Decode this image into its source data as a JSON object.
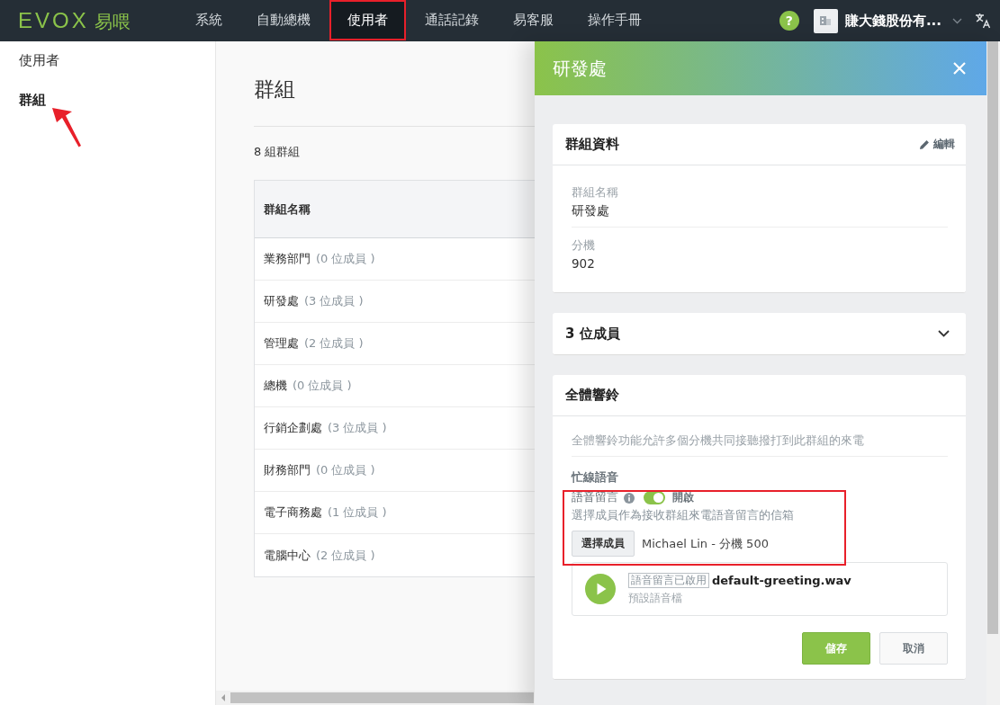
{
  "top_bar": {
    "logo": {
      "wordmark": "EVOX",
      "name": "易喂"
    },
    "nav": [
      {
        "label": "系統",
        "selected": false
      },
      {
        "label": "自動總機",
        "selected": false
      },
      {
        "label": "使用者",
        "selected": true
      },
      {
        "label": "通話記錄",
        "selected": false
      },
      {
        "label": "易客服",
        "selected": false
      },
      {
        "label": "操作手冊",
        "selected": false
      }
    ],
    "help": "?",
    "company": "賺大錢股份有..."
  },
  "sidebar": {
    "items": [
      {
        "label": "使用者",
        "selected": false
      },
      {
        "label": "群組",
        "selected": true
      }
    ]
  },
  "main": {
    "title": "群組",
    "count": "8 組群組",
    "table": {
      "columns": [
        "群組名稱"
      ],
      "rows": [
        {
          "name": "業務部門",
          "members": "(0 位成員 )"
        },
        {
          "name": "研發處",
          "members": "(3 位成員 )"
        },
        {
          "name": "管理處",
          "members": "(2 位成員 )"
        },
        {
          "name": "總機",
          "members": "(0 位成員 )"
        },
        {
          "name": "行銷企劃處",
          "members": "(3 位成員 )"
        },
        {
          "name": "財務部門",
          "members": "(0 位成員 )"
        },
        {
          "name": "電子商務處",
          "members": "(1 位成員 )"
        },
        {
          "name": "電腦中心",
          "members": "(2 位成員 )"
        }
      ]
    }
  },
  "drawer": {
    "title": "研發處",
    "info_card": {
      "title": "群組資料",
      "edit": "編輯",
      "fields": [
        {
          "label": "群組名稱",
          "value": "研發處"
        },
        {
          "label": "分機",
          "value": "902"
        }
      ]
    },
    "members_card": {
      "title": "3 位成員",
      "expanded": false
    },
    "ring_card": {
      "title": "全體響鈴",
      "description": "全體響鈴功能允許多個分機共同接聽撥打到此群組的來電",
      "busy_label": "忙線語音",
      "voicemail_label": "語音留言",
      "voicemail_on": true,
      "toggle_text": "開啟",
      "hint": "選擇成員作為接收群組來電語音留言的信箱",
      "select_button": "選擇成員",
      "selected_member": "Michael Lin - 分機 500",
      "greeting": {
        "tag": "語音留言已啟用",
        "file": "default-greeting.wav",
        "caption": "預設語音檔"
      },
      "save": "儲存",
      "cancel": "取消"
    }
  }
}
